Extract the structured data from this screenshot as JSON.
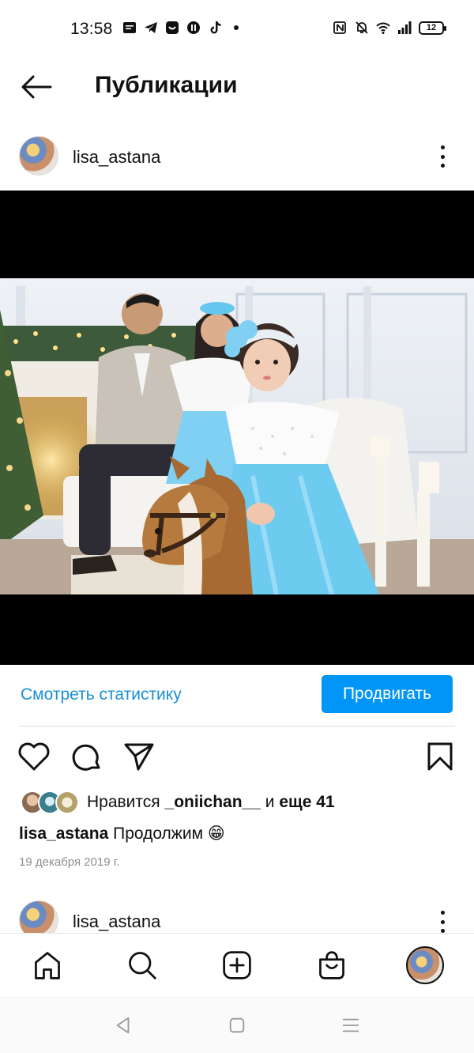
{
  "status_bar": {
    "time": "13:58",
    "battery": "12",
    "left_icons": [
      "message-icon",
      "telegram-icon",
      "app-icon",
      "app-icon",
      "tiktok-icon",
      "dot-icon"
    ],
    "right_icons": [
      "nfc-icon",
      "bell-off-icon",
      "wifi-icon",
      "signal-icon",
      "battery-icon"
    ]
  },
  "header": {
    "title": "Публикации",
    "back_icon": "arrow-left-icon"
  },
  "post": {
    "username": "lisa_astana",
    "more_icon": "more-vertical-icon",
    "stats_link": "Смотреть статистику",
    "promote_button": "Продвигать",
    "likes_prefix": "Нравится",
    "likes_user": "_oniichan__",
    "likes_and": "и",
    "likes_rest": "еще 41",
    "caption_user": "lisa_astana",
    "caption_text": "Продолжим 😁",
    "date": "19 декабря 2019 г."
  },
  "next_post": {
    "username": "lisa_astana"
  },
  "colors": {
    "accent": "#0095f6",
    "link": "#1a8fd6",
    "muted": "#8e8e8e"
  },
  "bottom_nav": [
    "home-icon",
    "search-icon",
    "add-icon",
    "shop-icon",
    "profile-avatar"
  ],
  "android_nav": [
    "back-triangle-icon",
    "home-square-icon",
    "menu-lines-icon"
  ]
}
